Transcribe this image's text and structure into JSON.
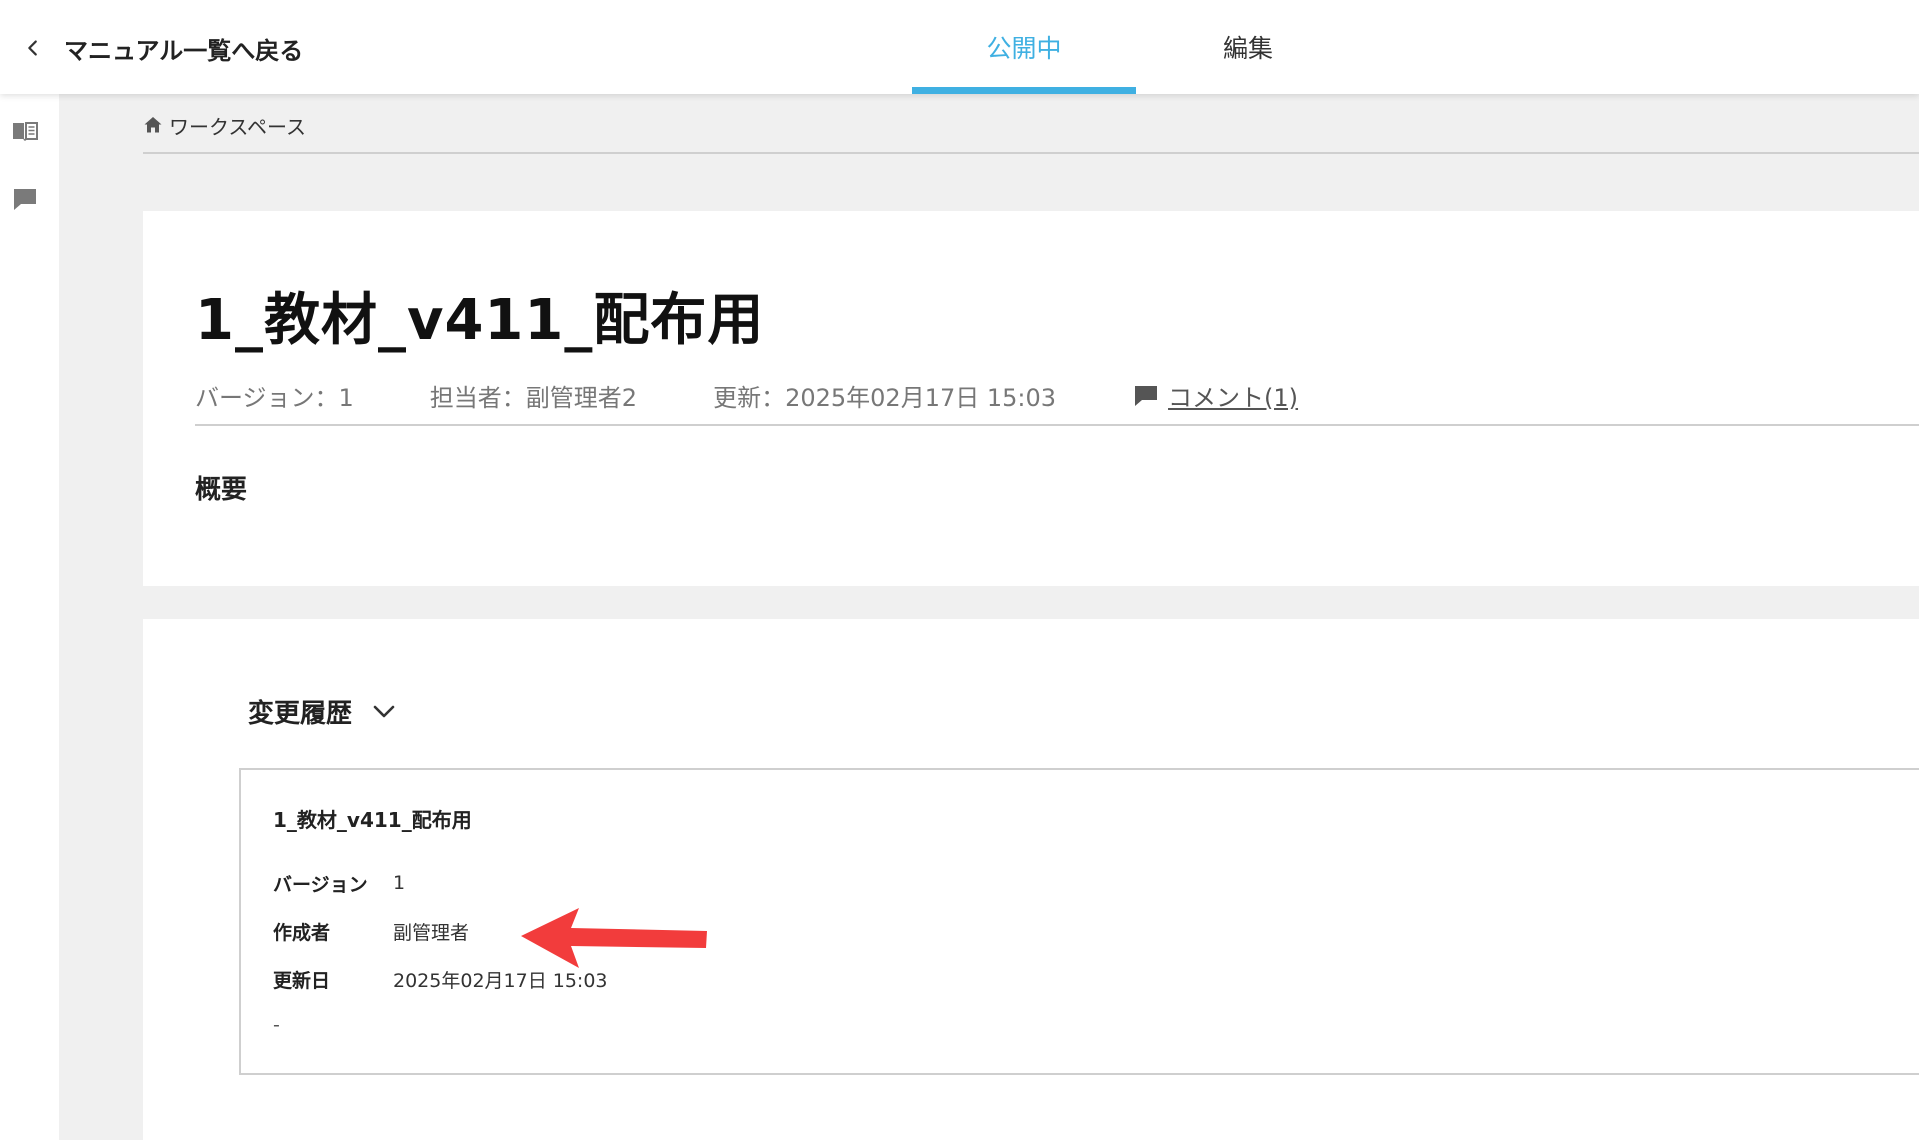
{
  "header": {
    "back_label": "マニュアル一覧へ戻る",
    "tabs": [
      {
        "label": "公開中",
        "active": true
      },
      {
        "label": "編集",
        "active": false
      }
    ],
    "accent_color": "#3fb0e2"
  },
  "rail": {
    "icons": [
      "book-icon",
      "comment-icon"
    ]
  },
  "breadcrumb": {
    "label": "ワークスペース"
  },
  "document": {
    "title": "1_教材_v411_配布用",
    "version": "バージョン：1",
    "assignee": "担当者：副管理者2",
    "updated": "更新：2025年02月17日 15:03",
    "comment_link": "コメント(1)",
    "summary_heading": "概要"
  },
  "history": {
    "heading": "変更履歴",
    "entry": {
      "title": "1_教材_v411_配布用",
      "version_label": "バージョン",
      "version_value": "1",
      "author_label": "作成者",
      "author_value": "副管理者",
      "updated_label": "更新日",
      "updated_value": "2025年02月17日 15:03",
      "note": "-"
    }
  },
  "annotation": {
    "arrow_color": "#f23c3c"
  }
}
